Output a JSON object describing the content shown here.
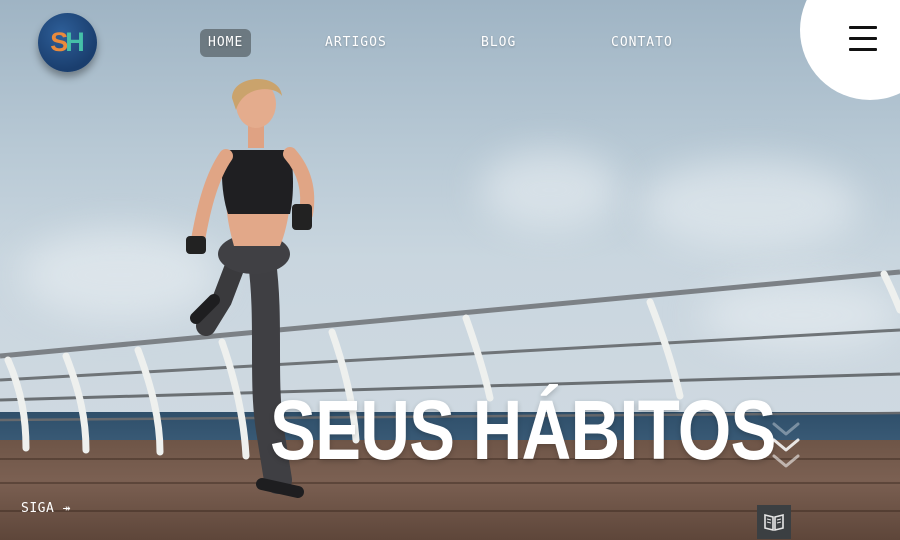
{
  "brand": {
    "logo_left": "S",
    "logo_right": "H",
    "logo_left_color": "#e98a3c",
    "logo_right_color": "#45c0a8",
    "logo_bg": "#1f4a80"
  },
  "nav": {
    "items": [
      {
        "label": "HOME",
        "active": true
      },
      {
        "label": "ARTIGOS",
        "active": false
      },
      {
        "label": "BLOG",
        "active": false
      },
      {
        "label": "CONTATO",
        "active": false
      }
    ]
  },
  "menu": {
    "icon": "hamburger-menu-icon"
  },
  "hero": {
    "title": "SEUS HÁBITOS",
    "scroll_icon": "chevrons-down-icon"
  },
  "footer": {
    "follow_label": "SIGA ↠",
    "book_icon": "open-book-icon"
  }
}
